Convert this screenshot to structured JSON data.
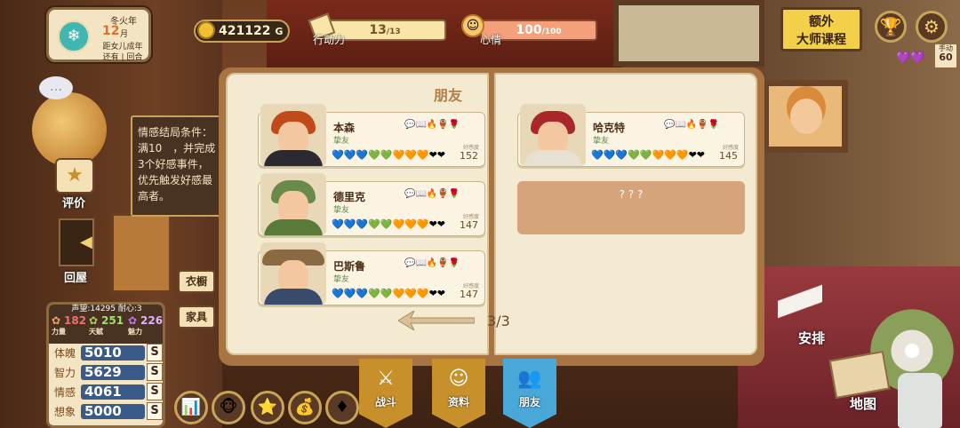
{
  "status": {
    "season": "冬火年",
    "month_number": "12",
    "month_unit": "月",
    "countdown": "距女儿成年",
    "remaining": "还有 | 回合",
    "gold": "421122",
    "gold_unit": "G",
    "stamina_label": "行动力",
    "stamina_value": "13",
    "stamina_max": "/13",
    "mood_label": "心情",
    "mood_value": "100",
    "mood_max": "/100",
    "hand_label": "手动",
    "hand_count": "60"
  },
  "topright": {
    "master_course_line1": "额外",
    "master_course_line2": "大师课程",
    "trophy_icon": "trophy-icon",
    "settings_icon": "gear-icon"
  },
  "tooltip": {
    "text": "情感结局条件：满10　，并完成3个好感事件，优先触发好感最高者。"
  },
  "side": {
    "evaluate": "评价",
    "back_room": "回屋",
    "wardrobe": "衣橱",
    "furniture": "家具"
  },
  "reputation": {
    "line": "声望:14295 耐心:3",
    "power_value": "182",
    "power_label": "力量",
    "talent_value": "251",
    "talent_label": "天赋",
    "charm_value": "226",
    "charm_label": "魅力"
  },
  "stats": [
    {
      "label": "体魄",
      "value": "5010",
      "grade": "S"
    },
    {
      "label": "智力",
      "value": "5629",
      "grade": "S"
    },
    {
      "label": "情感",
      "value": "4061",
      "grade": "S"
    },
    {
      "label": "想象",
      "value": "5000",
      "grade": "S"
    }
  ],
  "book": {
    "title": "朋友",
    "favor_label": "好感度",
    "friends": [
      {
        "name": "本森",
        "relation": "挚友",
        "favor": "152"
      },
      {
        "name": "德里克",
        "relation": "挚友",
        "favor": "147"
      },
      {
        "name": "巴斯鲁",
        "relation": "挚友",
        "favor": "147"
      },
      {
        "name": "哈克特",
        "relation": "挚友",
        "favor": "145"
      }
    ],
    "unknown": "? ? ?",
    "page": "3/3",
    "hearts": "💙💙💙💚💚🧡🧡🧡❤❤",
    "icons": "💬📖🔥🏺🌹"
  },
  "tabs": [
    {
      "label": "战斗",
      "icon": "⚔"
    },
    {
      "label": "资料",
      "icon": "☺"
    },
    {
      "label": "朋友",
      "icon": "👥"
    }
  ],
  "bottom_icons": [
    "📊",
    "🐵",
    "⭐",
    "💰",
    "♦"
  ],
  "right": {
    "arrange": "安排",
    "map": "地图"
  }
}
